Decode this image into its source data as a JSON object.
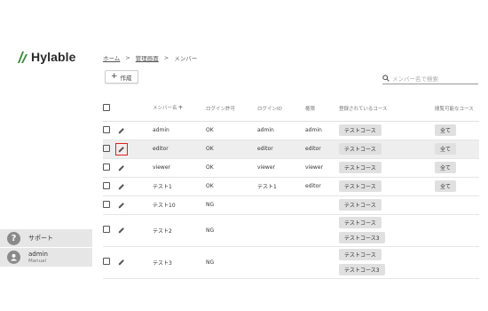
{
  "app": {
    "logo_text": "Hylable",
    "brand_color": "#3a8a3a"
  },
  "sidebar": {
    "support_label": "サポート",
    "user_name": "admin",
    "user_role": "Manual"
  },
  "breadcrumb": {
    "home": "ホーム",
    "admin": "管理画面",
    "current": "メンバー",
    "separator": ">"
  },
  "toolbar": {
    "create_label": "作成",
    "search_placeholder": "メンバー名で検索"
  },
  "table": {
    "headers": {
      "name": "メンバー名",
      "login_allowed": "ログイン許可",
      "login_id": "ログインID",
      "role": "権限",
      "registered_courses": "登録されているコース",
      "viewable_courses": "閲覧可能なコース"
    },
    "rows": [
      {
        "name": "admin",
        "login": "OK",
        "id": "admin",
        "role": "admin",
        "courses": [
          "テストコース"
        ],
        "view": "全て"
      },
      {
        "name": "editor",
        "login": "OK",
        "id": "editor",
        "role": "editor",
        "courses": [
          "テストコース"
        ],
        "view": "全て"
      },
      {
        "name": "viewer",
        "login": "OK",
        "id": "viewer",
        "role": "viewer",
        "courses": [
          "テストコース"
        ],
        "view": "全て"
      },
      {
        "name": "テスト1",
        "login": "OK",
        "id": "テスト1",
        "role": "editor",
        "courses": [
          "テストコース"
        ],
        "view": "全て"
      },
      {
        "name": "テスト10",
        "login": "NG",
        "id": "",
        "role": "",
        "courses": [
          "テストコース"
        ],
        "view": ""
      },
      {
        "name": "テスト2",
        "login": "NG",
        "id": "",
        "role": "",
        "courses": [
          "テストコース",
          "テストコース3"
        ],
        "view": ""
      },
      {
        "name": "テスト3",
        "login": "NG",
        "id": "",
        "role": "",
        "courses": [
          "テストコース",
          "テストコース3"
        ],
        "view": ""
      }
    ]
  }
}
